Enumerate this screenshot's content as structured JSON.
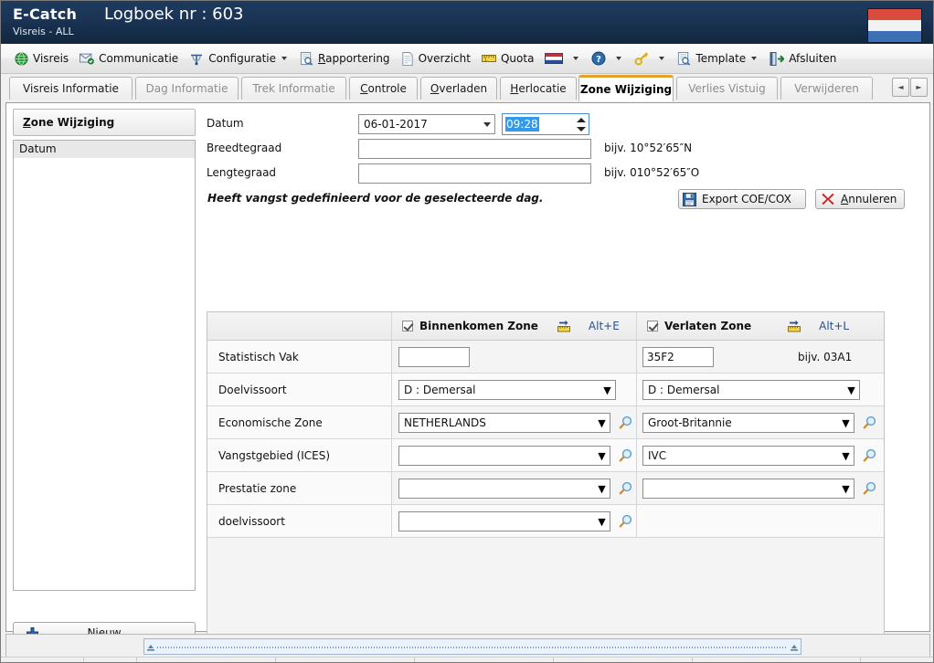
{
  "titlebar": {
    "app_name": "E-Catch",
    "subtitle": "Visreis - ALL",
    "title": "Logboek nr : 603",
    "flag_icon": "netherlands-flag-icon"
  },
  "toolbar": {
    "items": [
      {
        "label": "Visreis",
        "icon": "globe-icon",
        "caret": false
      },
      {
        "label": "Communicatie",
        "icon": "mail-icon",
        "caret": false
      },
      {
        "label": "Configuratie",
        "icon": "tools-icon",
        "caret": true
      },
      {
        "label": "Rapportering",
        "icon": "report-search-icon",
        "caret": false,
        "accel": "R"
      },
      {
        "label": "Overzicht",
        "icon": "document-icon",
        "caret": false
      },
      {
        "label": "Quota",
        "icon": "ruler-icon",
        "caret": false
      },
      {
        "label": "",
        "icon": "netherlands-flag-icon",
        "caret": true
      },
      {
        "label": "",
        "icon": "help-icon",
        "caret": true
      },
      {
        "label": "",
        "icon": "key-icon",
        "caret": true
      },
      {
        "label": "Template",
        "icon": "template-search-icon",
        "caret": true
      },
      {
        "label": "Afsluiten",
        "icon": "exit-door-icon",
        "caret": false
      }
    ]
  },
  "tabs": {
    "items": [
      {
        "label": "Visreis Informatie",
        "state": "enabled"
      },
      {
        "label": "Dag Informatie",
        "state": "disabled"
      },
      {
        "label": "Trek Informatie",
        "state": "disabled"
      },
      {
        "label": "Controle",
        "state": "enabled",
        "accel": "C"
      },
      {
        "label": "Overladen",
        "state": "enabled",
        "accel": "O"
      },
      {
        "label": "Herlocatie",
        "state": "enabled",
        "accel": "H"
      },
      {
        "label": "Zone Wijziging",
        "state": "active"
      },
      {
        "label": "Verlies Vistuig",
        "state": "disabled"
      },
      {
        "label": "Verwijderen",
        "state": "disabled"
      }
    ],
    "nav_prev": "◄",
    "nav_next": "►"
  },
  "left_panel": {
    "header": "Zone Wijziging",
    "header_accel": "Z",
    "items": [
      "Datum"
    ],
    "new_button": "Nieuw",
    "new_button_accel": "N",
    "new_button_icon": "plus-icon"
  },
  "form": {
    "datum_label": "Datum",
    "datum_value": "06-01-2017",
    "time_value": "09:28",
    "breedtegraad_label": "Breedtegraad",
    "breedtegraad_value": "",
    "breedtegraad_hint": "bijv. 10°52′65″N",
    "lengtegraad_label": "Lengtegraad",
    "lengtegraad_value": "",
    "lengtegraad_hint": "bijv. 010°52′65″O",
    "note": "Heeft vangst gedefinieerd voor de geselecteerde dag.",
    "export_button": "Export COE/COX",
    "export_button_icon": "save-floppy-icon",
    "cancel_button": "Annuleren",
    "cancel_button_accel": "A",
    "cancel_button_icon": "red-x-icon"
  },
  "zone_table": {
    "header": {
      "entering": {
        "label": "Binnenkomen Zone",
        "checked": true,
        "accel": "Alt+E",
        "icon": "zone-enter-icon"
      },
      "leaving": {
        "label": "Verlaten Zone",
        "checked": true,
        "accel": "Alt+L",
        "icon": "zone-leave-icon"
      }
    },
    "rows": [
      {
        "label": "Statistisch Vak",
        "type": "text",
        "entering": {
          "value": "",
          "magnifier": false
        },
        "leaving": {
          "value": "35F2",
          "magnifier": false,
          "hint": "bijv. 03A1"
        }
      },
      {
        "label": "Doelvissoort",
        "type": "combo",
        "entering": {
          "value": "D : Demersal",
          "magnifier": false
        },
        "leaving": {
          "value": "D : Demersal",
          "magnifier": false
        }
      },
      {
        "label": "Economische Zone",
        "type": "combo",
        "entering": {
          "value": "NETHERLANDS",
          "magnifier": true
        },
        "leaving": {
          "value": "Groot-Britannie",
          "magnifier": true
        }
      },
      {
        "label": "Vangstgebied (ICES)",
        "type": "combo",
        "entering": {
          "value": "",
          "magnifier": true
        },
        "leaving": {
          "value": "IVC",
          "magnifier": true
        }
      },
      {
        "label": "Prestatie zone",
        "type": "combo",
        "entering": {
          "value": "",
          "magnifier": true
        },
        "leaving": {
          "value": "",
          "magnifier": true
        }
      },
      {
        "label": "doelvissoort",
        "type": "combo",
        "entering": {
          "value": "",
          "magnifier": true
        },
        "leaving": {
          "value": "",
          "magnifier": false
        }
      }
    ]
  },
  "colors": {
    "titlebar_dark": "#13283f",
    "active_tab_accent": "#e0a32e",
    "selection_blue": "#3399e8",
    "accel_text": "#2b4f8e"
  },
  "scrollbar": {
    "icon_left": "scroll-left-grip",
    "icon_right": "scroll-right-grip"
  }
}
